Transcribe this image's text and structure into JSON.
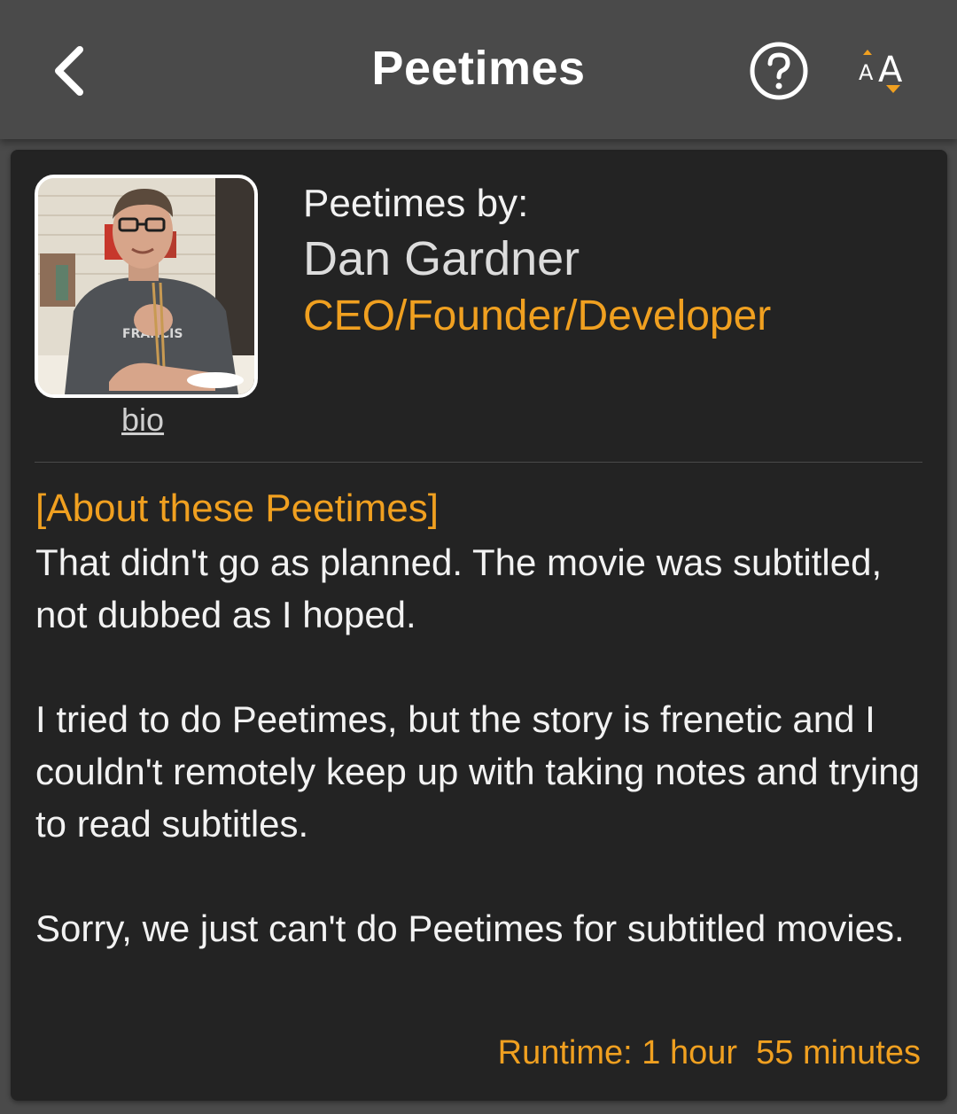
{
  "header": {
    "title": "Peetimes",
    "back_icon": "chevron-left-icon",
    "help_icon": "question-circle-icon",
    "font_size_icon": "font-size-icon"
  },
  "author": {
    "by_label": "Peetimes by:",
    "name": "Dan Gardner",
    "role": "CEO/Founder/Developer",
    "bio_link": "bio"
  },
  "about": {
    "heading": "[About these Peetimes]",
    "paragraphs": [
      "That didn't go as planned. The movie was subtitled, not dubbed as I hoped.",
      "I tried to do Peetimes, but the story is frenetic and I couldn't remotely keep up with taking notes and trying to read subtitles.",
      "Sorry, we just can't do Peetimes for subtitled movies."
    ]
  },
  "runtime": "Runtime: 1 hour  55 minutes",
  "colors": {
    "accent": "#f0a020",
    "card_bg": "#232323",
    "header_bg": "#4a4a4a",
    "text": "#f2f2f2"
  }
}
